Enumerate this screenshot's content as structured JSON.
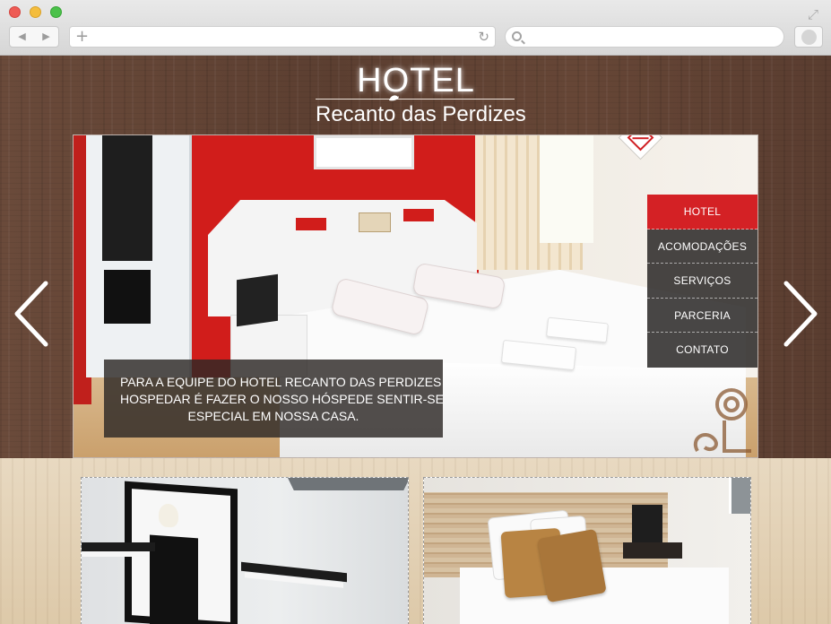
{
  "browser": {
    "nav_back": "◀",
    "nav_forward": "▶",
    "new_tab_icon": "plus-icon",
    "reload_icon": "reload-icon",
    "search_icon": "search-icon",
    "expand_icon": "expand-icon",
    "plus_glyph": "+",
    "reload_glyph": "↻",
    "expand_glyph": "⤢",
    "address": "",
    "search": ""
  },
  "logo": {
    "title": "HOTEL",
    "subtitle": "Recanto das Perdizes"
  },
  "slider": {
    "caption": [
      "PARA A EQUIPE DO HOTEL RECANTO DAS PERDIZES",
      "HOSPEDAR É FAZER O NOSSO HÓSPEDE SENTIR-SE",
      "ESPECIAL EM NOSSA CASA."
    ],
    "arrow_prev": "chevron-left-icon",
    "arrow_next": "chevron-right-icon"
  },
  "menu": {
    "items": [
      {
        "label": "HOTEL",
        "active": true
      },
      {
        "label": "ACOMODAÇÕES",
        "active": false
      },
      {
        "label": "SERVIÇOS",
        "active": false
      },
      {
        "label": "PARCERIA",
        "active": false
      },
      {
        "label": "CONTATO",
        "active": false
      }
    ]
  },
  "colors": {
    "accent": "#d42125",
    "menu_bg": "#2a2624",
    "wood_dark": "#5e4132",
    "wood_light": "#e3d3b8"
  },
  "thumbnails": [
    {
      "name": "room-decor-photo"
    },
    {
      "name": "room-bed-photo"
    }
  ]
}
